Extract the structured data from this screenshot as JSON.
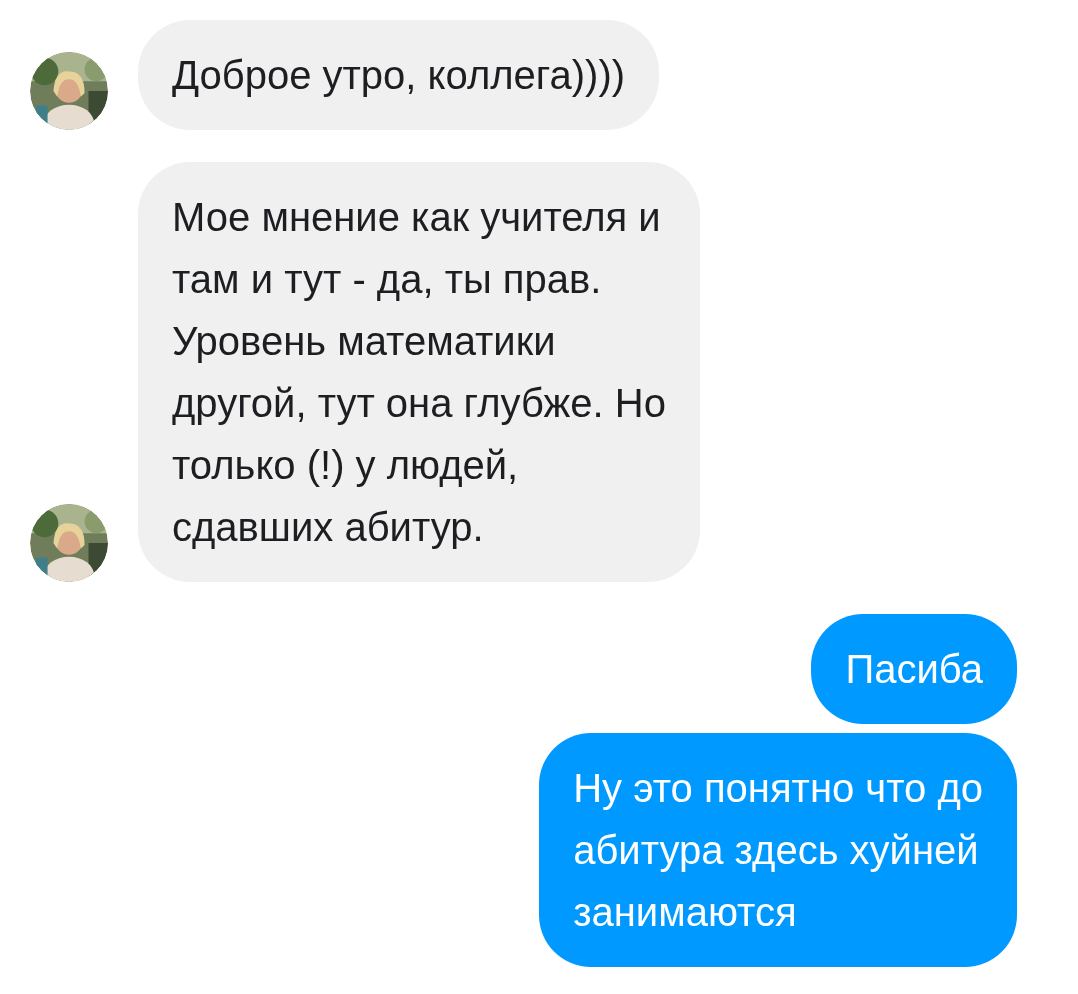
{
  "messages": [
    {
      "kind": "incoming",
      "text": "Доброе утро, коллега))))"
    },
    {
      "kind": "incoming",
      "text": "Мое мнение как учителя и\nтам и тут - да, ты прав.\nУровень математики\nдругой, тут она глубже. Но\nтолько (!) у людей,\nсдавших абитур."
    },
    {
      "kind": "outgoing",
      "text": "Пасиба"
    },
    {
      "kind": "outgoing",
      "text": "Ну это понятно что до\nабитура здесь хуйней\nзанимаются"
    }
  ]
}
